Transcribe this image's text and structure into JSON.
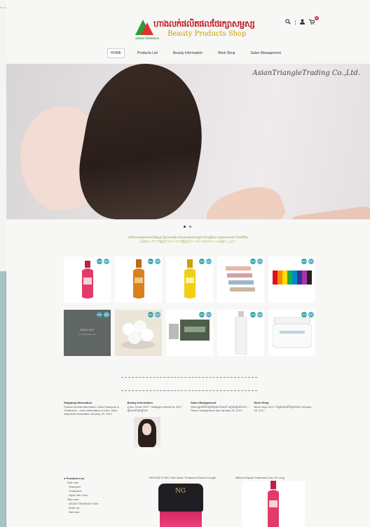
{
  "header": {
    "logo_khmer": "ហាងលក់ផលិតផលថែរក្សាសម្ផស្ស",
    "logo_english": "Beauty Products Shop",
    "logo_tagline": "ASIAN TRIANGLE",
    "search_icon": "search-icon",
    "user_icon": "user-icon",
    "cart_icon": "cart-icon",
    "cart_count": "0"
  },
  "nav": {
    "items": [
      "HOME",
      "Products List",
      "Beauty Information",
      "Work Shop",
      "Salon Management"
    ]
  },
  "hero": {
    "brand_text": "AsianTriangleTrading Co.,Ltd."
  },
  "intro": {
    "line1": "ផលិតផលសម្រាប់សក់ និងស្បែក ពីប្រទេសជប៉ុន ដែលមានគុណភាពខ្ពស់ និងសុវត្ថិភាព សម្រាប់ហាងសក់ និងអតិថិជន",
    "line2": "日本のヘアケア製品やスキンケア製品をカンボジアのサロンへお届けします。"
  },
  "product_tags": {
    "a": "NEW",
    "b": "HOT"
  },
  "gray_card": {
    "title": "SOLD OUT",
    "subtitle": "Coming back soon"
  },
  "footer_cols": [
    {
      "heading": "Shipping Information",
      "body": "Product arrival information. New Shampoo & Treatment... more information is here. Next shipment information January 20, 2017"
    },
    {
      "heading": "Beauty Information",
      "body": "Color Trend 2017 / Intelligent Mode for 2017 ស្ទីលសក់ចុងក្រោយ"
    },
    {
      "heading": "Salon Management",
      "body": "Q&A ស្គាល់ពីការគ្រប់គ្រងហាងសក់ សម្រាប់ម្ចាស់ហាង ... Salon management tips January 20, 2017"
    },
    {
      "heading": "Work Shop",
      "body": "Work shop 2017 / ស្វែងយល់ពីបច្ចេកទេស January 20, 2017"
    }
  ],
  "categories": {
    "heading": "Products List",
    "items": [
      "Hair care",
      "Shampoo",
      "Treatment",
      "Style Hair Care",
      "Skin care",
      "ASIAN TRIANGLE Skin",
      "Make up",
      "Nail care"
    ]
  },
  "products_bottom": [
    {
      "name": "DEESSE'S NEU Hair Wave Treatment Recent Length"
    },
    {
      "name": "Milbon Elujuda Treatment Hair Oil Long"
    }
  ],
  "jar_brand": "NG"
}
